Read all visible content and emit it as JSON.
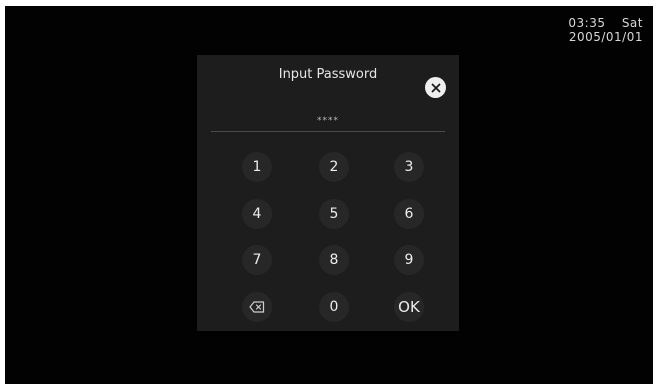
{
  "status_bar": {
    "time": "03:35",
    "day": "Sat",
    "date": "2005/01/01"
  },
  "dialog": {
    "title": "Input Password",
    "close_icon": "close-icon",
    "password_mask": "****"
  },
  "keypad": {
    "keys": [
      "1",
      "2",
      "3",
      "4",
      "5",
      "6",
      "7",
      "8",
      "9"
    ],
    "backspace_icon": "backspace-icon",
    "zero": "0",
    "ok": "OK"
  },
  "colors": {
    "screen_background": "#020202",
    "dialog_background": "#1d1d1d",
    "key_background": "#272727",
    "text": "#ededed"
  }
}
